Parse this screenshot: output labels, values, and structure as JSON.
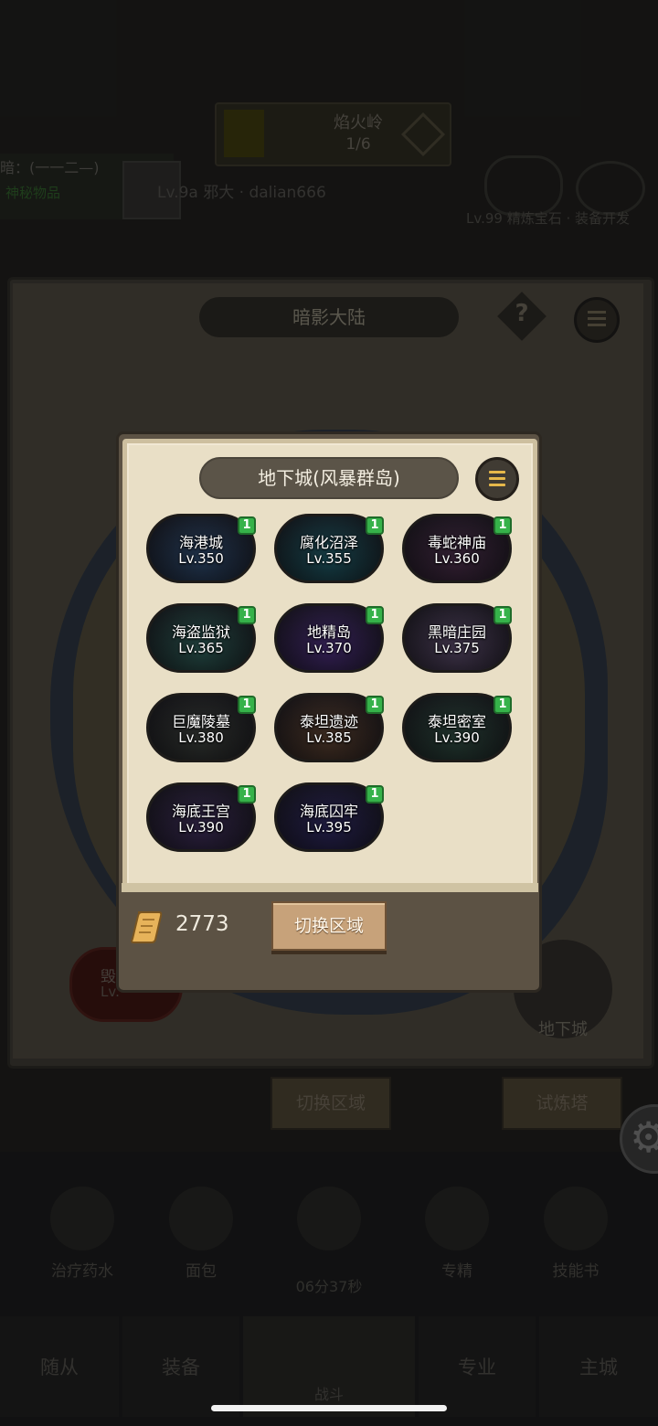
{
  "background": {
    "top_bar": {
      "title": "焰火岭",
      "progress": "1/6"
    },
    "player_info": {
      "line1": "暗：(一一二—)",
      "line2": "神秘物品",
      "player": "Lv.9a 邪大 · dalian666"
    },
    "right_text": "Lv.99 精炼宝石 · 装备开发",
    "map_title": "暗影大陆",
    "dungeon_label": "地下城",
    "red_tile": {
      "name": "毁",
      "level": "Lv."
    },
    "buttons": [
      "切换区域",
      "试炼塔"
    ],
    "items": [
      {
        "label": "治疗药水"
      },
      {
        "label": "面包"
      },
      {
        "label": ""
      },
      {
        "label": "专精"
      },
      {
        "label": "技能书"
      }
    ],
    "timer": "06分37秒",
    "nav": [
      "随从",
      "装备",
      "战斗",
      "专业",
      "主城"
    ]
  },
  "popup": {
    "title": "地下城(风暴群岛)",
    "dungeons": [
      {
        "name": "海港城",
        "level": "Lv.350",
        "badge": "1",
        "color": "#2e4a6e"
      },
      {
        "name": "腐化沼泽",
        "level": "Lv.355",
        "badge": "1",
        "color": "#1f5a66"
      },
      {
        "name": "毒蛇神庙",
        "level": "Lv.360",
        "badge": "1",
        "color": "#4a2e4a"
      },
      {
        "name": "海盗监狱",
        "level": "Lv.365",
        "badge": "1",
        "color": "#2e5e58"
      },
      {
        "name": "地精岛",
        "level": "Lv.370",
        "badge": "1",
        "color": "#4a2e7a"
      },
      {
        "name": "黑暗庄园",
        "level": "Lv.375",
        "badge": "1",
        "color": "#5a4a6a"
      },
      {
        "name": "巨魔陵墓",
        "level": "Lv.380",
        "badge": "1",
        "color": "#3a3e3a"
      },
      {
        "name": "泰坦遗迹",
        "level": "Lv.385",
        "badge": "1",
        "color": "#5a4030"
      },
      {
        "name": "泰坦密室",
        "level": "Lv.390",
        "badge": "1",
        "color": "#2e4a40"
      },
      {
        "name": "海底王宫",
        "level": "Lv.390",
        "badge": "1",
        "color": "#3e2e5a"
      },
      {
        "name": "海底囚牢",
        "level": "Lv.395",
        "badge": "1",
        "color": "#2e2860"
      }
    ],
    "currency": "2773",
    "switch_button": "切换区域"
  }
}
